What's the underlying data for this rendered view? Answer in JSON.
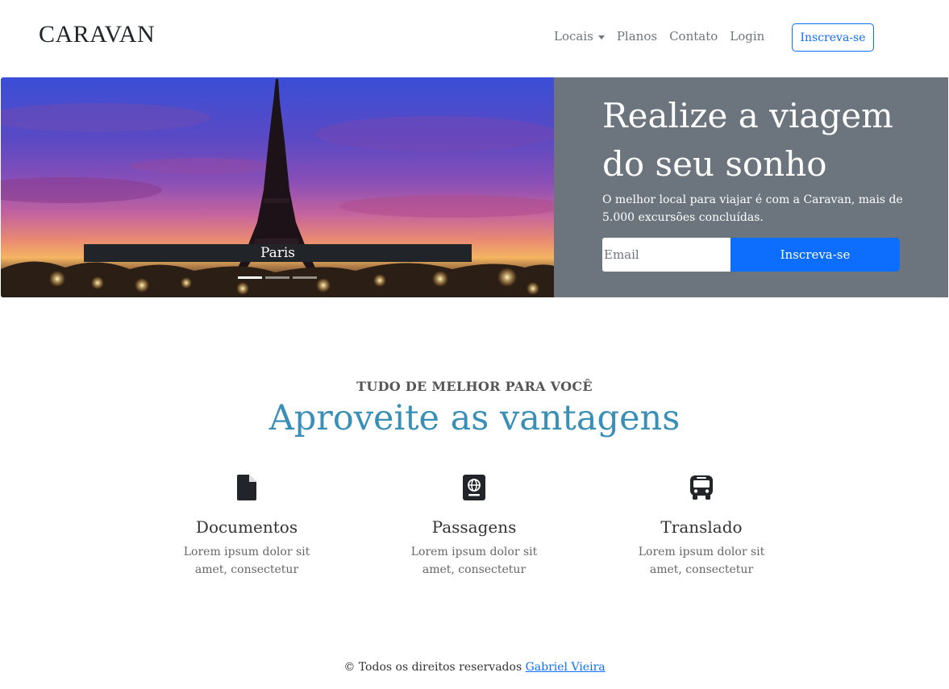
{
  "navbar": {
    "brand": "CARAVAN",
    "links": [
      "Locais",
      "Planos",
      "Contato",
      "Login"
    ],
    "signup_button": "Inscreva-se"
  },
  "hero": {
    "carousel": {
      "caption": "Paris",
      "slide_count": 3,
      "active_slide": 1
    },
    "title": "Realize a viagem do seu sonho",
    "text": "O melhor local para viajar é com a Caravan, mais de 5.000 excursões concluídas.",
    "email_placeholder": "Email",
    "subscribe_button": "Inscreva-se",
    "panel_color": "#6c757d",
    "button_color": "#0d6efd"
  },
  "features": {
    "kicker": "TUDO DE MELHOR PARA VOCÊ",
    "title": "Aproveite as vantagens",
    "title_color": "#3a8fb7",
    "items": [
      {
        "icon": "file-icon",
        "title": "Documentos",
        "text": "Lorem ipsum dolor sit amet, consectetur"
      },
      {
        "icon": "passport-icon",
        "title": "Passagens",
        "text": "Lorem ipsum dolor sit amet, consectetur"
      },
      {
        "icon": "bus-icon",
        "title": "Translado",
        "text": "Lorem ipsum dolor sit amet, consectetur"
      }
    ]
  },
  "footer": {
    "text": "© Todos os direitos reservados",
    "link": "Gabriel Vieira"
  }
}
